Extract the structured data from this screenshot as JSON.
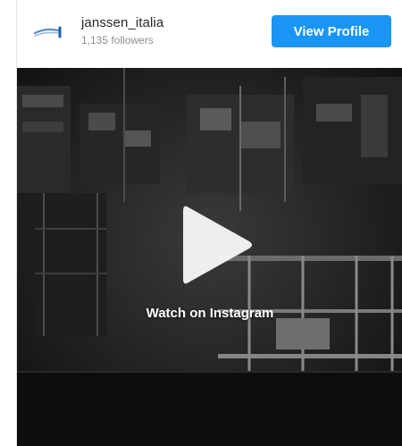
{
  "profile": {
    "username": "janssen_italia",
    "followers": "1,135 followers",
    "view_profile_label": "View Profile",
    "avatar_icon": "janssen-logo-icon"
  },
  "media": {
    "type": "video",
    "watch_label": "Watch on Instagram",
    "play_icon": "play-icon"
  },
  "colors": {
    "button": "#1a95f4",
    "username": "#262626",
    "followers": "#8e8e8e",
    "media_background": "#141414"
  }
}
